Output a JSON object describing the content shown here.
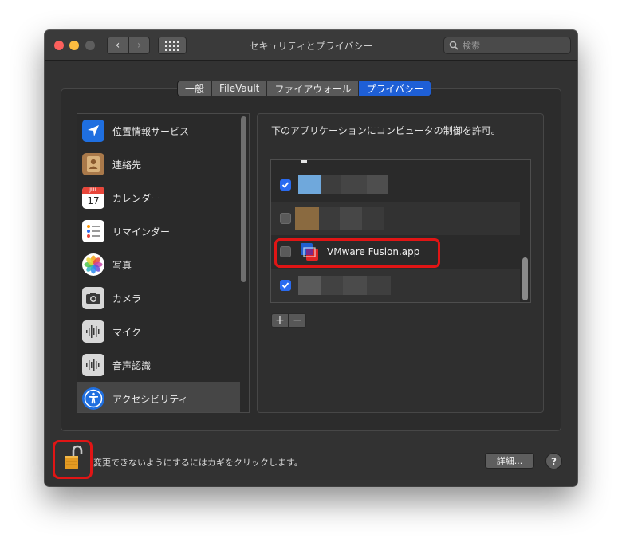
{
  "window": {
    "title": "セキュリティとプライバシー",
    "search_placeholder": "検索"
  },
  "tabs": [
    {
      "label": "一般",
      "active": false
    },
    {
      "label": "FileVault",
      "active": false
    },
    {
      "label": "ファイアウォール",
      "active": false
    },
    {
      "label": "プライバシー",
      "active": true
    }
  ],
  "sidebar": {
    "items": [
      {
        "label": "位置情報サービス",
        "icon": "location-arrow-icon"
      },
      {
        "label": "連絡先",
        "icon": "contacts-book-icon"
      },
      {
        "label": "カレンダー",
        "icon": "calendar-icon",
        "icon_month": "JUL",
        "icon_day": "17"
      },
      {
        "label": "リマインダー",
        "icon": "reminders-icon"
      },
      {
        "label": "写真",
        "icon": "photos-flower-icon"
      },
      {
        "label": "カメラ",
        "icon": "camera-icon"
      },
      {
        "label": "マイク",
        "icon": "microphone-waveform-icon"
      },
      {
        "label": "音声認識",
        "icon": "speech-recognition-waveform-icon"
      },
      {
        "label": "アクセシビリティ",
        "icon": "accessibility-icon",
        "selected": true
      }
    ]
  },
  "panel": {
    "title": "下のアプリケーションにコンピュータの制御を許可。",
    "apps": [
      {
        "label": "",
        "checked": true
      },
      {
        "label": "",
        "checked": false
      },
      {
        "label": "VMware Fusion.app",
        "checked": false
      },
      {
        "label": "",
        "checked": true
      }
    ],
    "add_label": "+",
    "remove_label": "−"
  },
  "footer": {
    "lock_text": "変更できないようにするにはカギをクリックします。",
    "details_label": "詳細...",
    "help_label": "?"
  },
  "colors": {
    "accent": "#1e5fd6",
    "highlight_annotation": "#e01515"
  }
}
